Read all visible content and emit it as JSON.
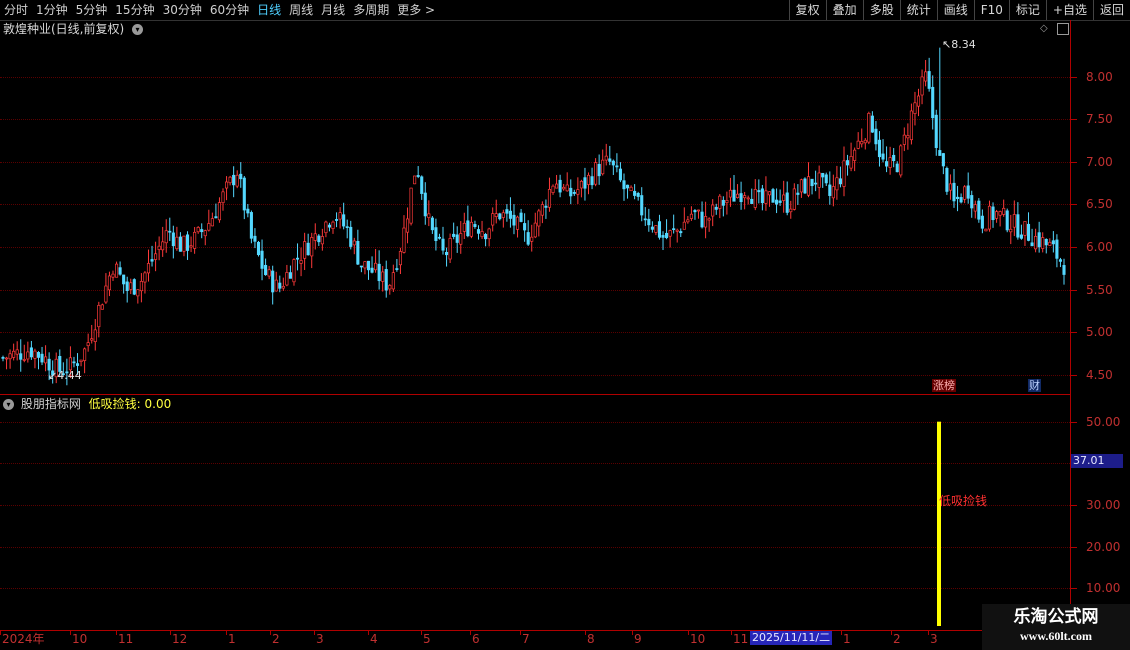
{
  "toolbar": {
    "periods": [
      "分时",
      "1分钟",
      "5分钟",
      "15分钟",
      "30分钟",
      "60分钟",
      "日线",
      "周线",
      "月线",
      "多周期",
      "更多 >"
    ],
    "active_period": "日线",
    "actions": [
      "复权",
      "叠加",
      "多股",
      "统计",
      "画线",
      "F10",
      "标记",
      "+自选",
      "返回"
    ]
  },
  "main_chart": {
    "title": "敦煌种业(日线,前复权)",
    "max_label": "8.34",
    "min_label": "4.44",
    "badges": {
      "limit_up": "涨榜",
      "finance": "财"
    }
  },
  "indicator": {
    "title": "股朋指标网",
    "value_label": "低吸捡钱: 0.00",
    "signal_label": "低吸捡钱",
    "current_value": "37.01",
    "signal_value": 50
  },
  "time_axis": {
    "highlight": "2025/11/11/二"
  },
  "watermark": {
    "line1": "乐淘公式网",
    "line2": "www.60lt.com"
  },
  "colors": {
    "up": "#ff3a3a",
    "down": "#54d8ff",
    "signal": "#ffff00",
    "axis": "#b00000"
  },
  "chart_data": [
    {
      "type": "candlestick",
      "title": "敦煌种业(日线,前复权)",
      "y_ticks": [
        4.5,
        5.0,
        5.5,
        6.0,
        6.5,
        7.0,
        7.5,
        8.0
      ],
      "ylim": [
        4.3,
        8.5
      ],
      "x_ticks": [
        "2024年",
        "10",
        "11",
        "12",
        "1",
        "2",
        "3",
        "4",
        "5",
        "6",
        "7",
        "8",
        "9",
        "10",
        "11",
        "2025/11/11/二",
        "1",
        "2",
        "3"
      ],
      "close_trend": [
        4.7,
        4.75,
        4.8,
        4.7,
        4.55,
        4.6,
        4.8,
        5.3,
        5.8,
        5.5,
        5.6,
        5.9,
        6.2,
        6.0,
        6.1,
        6.3,
        6.6,
        6.9,
        6.1,
        5.7,
        5.5,
        5.8,
        6.0,
        6.2,
        6.4,
        6.2,
        5.8,
        5.7,
        5.55,
        6.1,
        7.0,
        6.2,
        5.9,
        6.1,
        6.3,
        6.2,
        6.4,
        6.3,
        6.1,
        6.4,
        6.8,
        6.6,
        6.7,
        6.9,
        7.0,
        6.7,
        6.5,
        6.3,
        6.1,
        6.2,
        6.4,
        6.3,
        6.5,
        6.6,
        6.7,
        6.5,
        6.6,
        6.5,
        6.7,
        6.8,
        6.6,
        6.9,
        7.2,
        7.5,
        6.9,
        7.0,
        7.6,
        8.0,
        7.0,
        6.5,
        6.7,
        6.3,
        6.4,
        6.3,
        6.2,
        6.1,
        6.0,
        5.8
      ],
      "max": 8.34,
      "min": 4.44
    },
    {
      "type": "bar",
      "title": "股朋指标网",
      "y_ticks": [
        10.0,
        20.0,
        30.0,
        40.0,
        50.0
      ],
      "ylim": [
        0,
        54
      ],
      "series": [
        {
          "name": "低吸捡钱",
          "values": [
            50
          ]
        }
      ]
    }
  ]
}
